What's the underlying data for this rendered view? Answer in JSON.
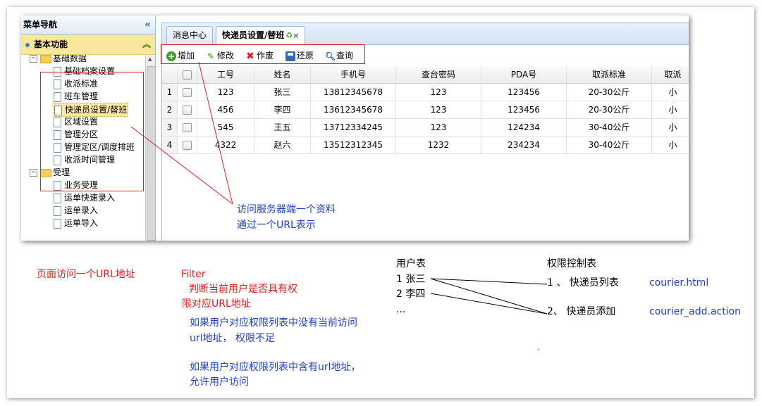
{
  "menu": {
    "title": "菜单导航",
    "collapse_icon": "«",
    "section_title": "基本功能",
    "section_icon": "︽"
  },
  "tree": [
    {
      "label": "基础数据",
      "type": "folder",
      "expander": "−"
    },
    {
      "label": "基础档案设置",
      "type": "file"
    },
    {
      "label": "收派标准",
      "type": "file"
    },
    {
      "label": "班车管理",
      "type": "file"
    },
    {
      "label": "快递员设置/替班",
      "type": "file",
      "selected": true
    },
    {
      "label": "区域设置",
      "type": "file"
    },
    {
      "label": "管理分区",
      "type": "file"
    },
    {
      "label": "管理定区/调度排班",
      "type": "file"
    },
    {
      "label": "收派时间管理",
      "type": "file"
    },
    {
      "label": "受理",
      "type": "folder",
      "expander": "−"
    },
    {
      "label": "业务受理",
      "type": "file"
    },
    {
      "label": "运单快速录入",
      "type": "file"
    },
    {
      "label": "运单录入",
      "type": "file"
    },
    {
      "label": "运单导入",
      "type": "file"
    }
  ],
  "tabs": [
    {
      "label": "消息中心",
      "active": false
    },
    {
      "label": "快递员设置/替班",
      "active": true,
      "close": "×"
    }
  ],
  "toolbar": {
    "add": "增加",
    "edit": "修改",
    "delete": "作废",
    "restore": "还原",
    "search": "查询"
  },
  "grid": {
    "headers": [
      "",
      "",
      "工号",
      "姓名",
      "手机号",
      "查台密码",
      "PDA号",
      "取派标准",
      "取派"
    ],
    "rows": [
      [
        "1",
        "123",
        "张三",
        "13812345678",
        "123",
        "123456",
        "20-30公斤",
        "小"
      ],
      [
        "2",
        "456",
        "李四",
        "13612345678",
        "123",
        "123456",
        "20-30公斤",
        "小"
      ],
      [
        "3",
        "545",
        "王五",
        "13712334245",
        "123",
        "124234",
        "30-40公斤",
        "小"
      ],
      [
        "4",
        "4322",
        "赵六",
        "13512312345",
        "1232",
        "234234",
        "30-40公斤",
        "小"
      ]
    ]
  },
  "annotations": {
    "server_line1": "访问服务器端一个资料",
    "server_line2": "通过一个URL表示",
    "page_url": "页面访问一个URL地址",
    "filter": "Filter",
    "filter_desc1": "判断当前用户是否具有权",
    "filter_desc2": "限对应URL地址",
    "deny1": "如果用户对应权限列表中没有当前访问",
    "deny2": "url地址， 权限不足",
    "allow1": "如果用户对应权限列表中含有url地址，",
    "allow2": "允许用户访问",
    "user_table": "用户表",
    "user1": "1  张三",
    "user2": "2  李四",
    "user_more": "...",
    "perm_table": "权限控制表",
    "perm1": "1 、  快递员列表",
    "perm2": "2、   快递员添加",
    "url1": "courier.html",
    "url2": "courier_add.action",
    "dot": "."
  },
  "colors": {
    "annotation_blue": "#1c3fc8",
    "annotation_red": "#e01a1a",
    "highlight_box": "#e02020",
    "section_header": "#fbe79b",
    "panel_border": "#99bbe8"
  }
}
